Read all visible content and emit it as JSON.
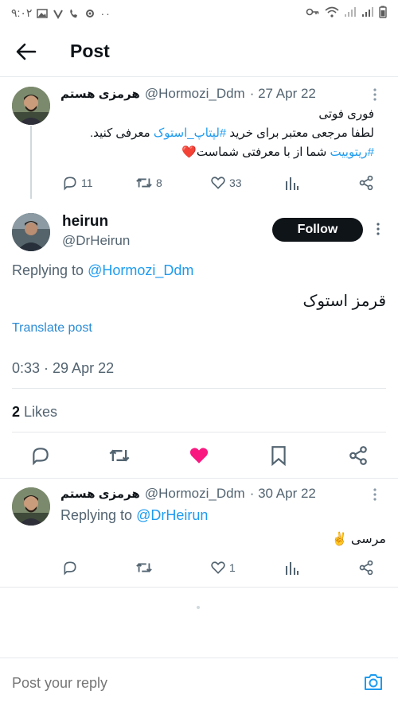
{
  "status_bar": {
    "time": "۹:۰۲"
  },
  "header": {
    "title": "Post"
  },
  "parent_tweet": {
    "display_name": "هرمزی هستم",
    "handle": "@Hormozi_Ddm",
    "date": "· 27 Apr 22",
    "line1": "فوری فوتی",
    "line2_a": "لطفا مرجعی معتبر برای خرید ",
    "line2_tag": "#لپتاپ_استوک",
    "line2_b": " معرفی کنید.",
    "line3_tag": "#ریتوییت",
    "line3_b": " شما از با معرفتی شماست",
    "line3_emoji": "❤️",
    "replies": "11",
    "retweets": "8",
    "likes": "33"
  },
  "main_tweet": {
    "display_name": "heirun",
    "handle": "@DrHeirun",
    "follow_label": "Follow",
    "replying_label": "Replying to",
    "replying_to": "@Hormozi_Ddm",
    "text": "قرمز استوک",
    "translate_label": "Translate post",
    "timestamp": "0:33 · 29 Apr 22",
    "likes_count": "2",
    "likes_label": "Likes"
  },
  "reply_tweet": {
    "display_name": "هرمزی هستم",
    "handle": "@Hormozi_Ddm",
    "date": "· 30 Apr 22",
    "replying_label": "Replying to",
    "replying_to": "@DrHeirun",
    "text": "مرسی",
    "emoji": "✌️",
    "likes": "1"
  },
  "compose": {
    "placeholder": "Post your reply"
  },
  "colors": {
    "accent": "#1d9bf0",
    "like": "#f91880",
    "text": "#0f1419",
    "muted": "#536471"
  }
}
